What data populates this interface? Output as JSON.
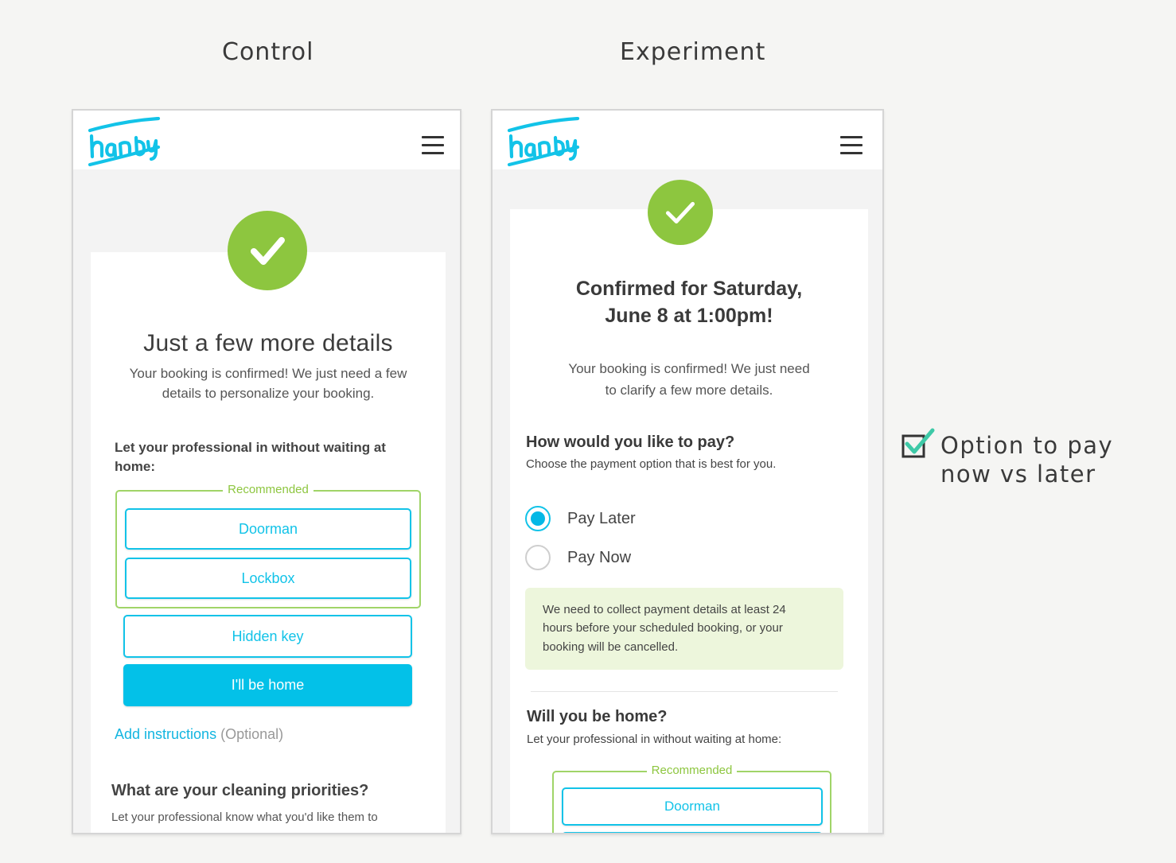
{
  "headings": {
    "control": "Control",
    "experiment": "Experiment"
  },
  "brand": {
    "logo_text": "handy",
    "accent": "#12c3e8",
    "success": "#8dc63f"
  },
  "control": {
    "title": "Just a few more details",
    "subtitle_line1": "Your booking is confirmed! We just need a few",
    "subtitle_line2": "details to personalize your booking.",
    "access_question_line1": "Let your professional in without waiting at",
    "access_question_line2": "home:",
    "recommended_label": "Recommended",
    "options": {
      "doorman": "Doorman",
      "lockbox": "Lockbox",
      "hidden_key": "Hidden key",
      "home": "I'll be home"
    },
    "add_instructions": "Add instructions",
    "optional": "(Optional)",
    "priorities_title": "What are your cleaning priorities?",
    "priorities_desc": "Let your professional know what you'd like them to"
  },
  "experiment": {
    "title_line1": "Confirmed for Saturday,",
    "title_line2": "June 8 at 1:00pm!",
    "subtitle_line1": "Your booking is confirmed! We just need",
    "subtitle_line2": "to clarify a few more details.",
    "pay_question": "How would you like to pay?",
    "pay_hint": "Choose the payment option that is best for you.",
    "pay_later": "Pay Later",
    "pay_now": "Pay Now",
    "selected_option": "Pay Later",
    "note_line1": "We need to collect payment details at least 24",
    "note_line2": "hours before your scheduled booking, or your",
    "note_line3": "booking will be cancelled.",
    "home_question": "Will you be home?",
    "home_hint": "Let your professional in without waiting at home:",
    "recommended_label": "Recommended",
    "doorman": "Doorman"
  },
  "annotation": {
    "line1": "Option to pay",
    "line2": "now vs later",
    "icon": "checkbox-checked-icon"
  }
}
